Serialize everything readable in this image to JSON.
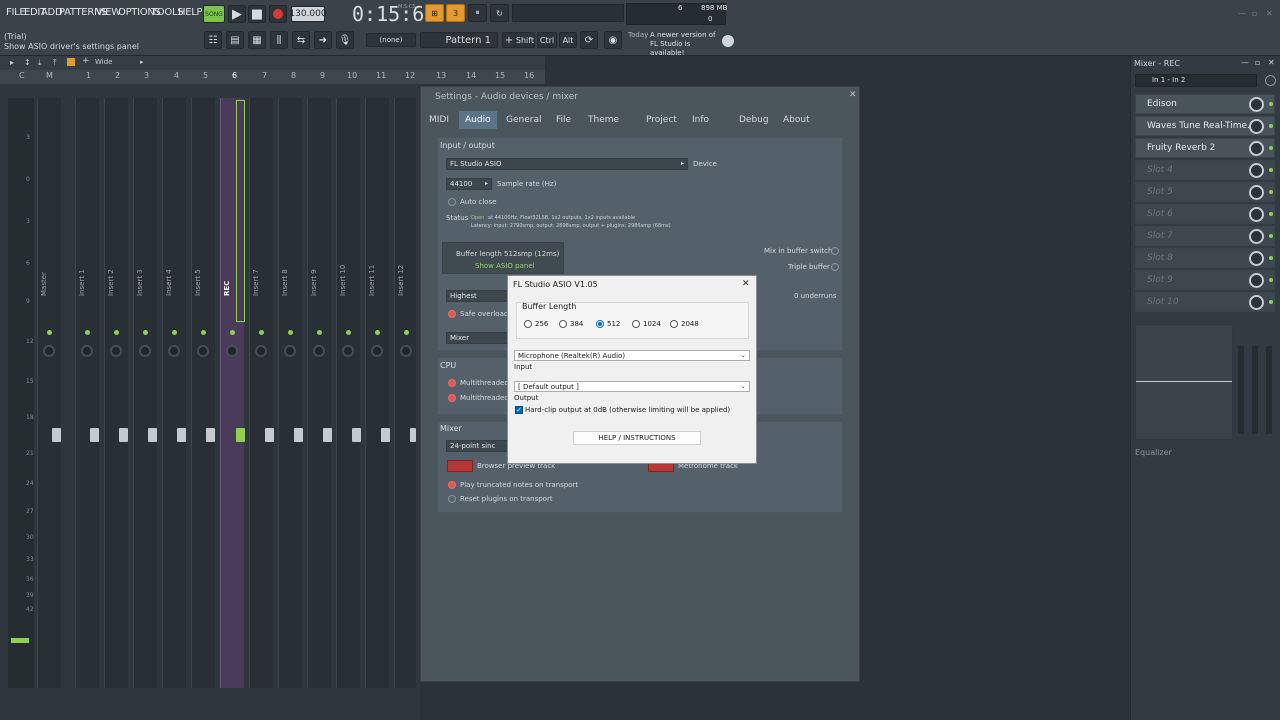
{
  "menu": [
    "FILE",
    "EDIT",
    "ADD",
    "PATTERNS",
    "VIEW",
    "OPTIONS",
    "TOOLS",
    "HELP"
  ],
  "hint": {
    "line1": "(Trial)",
    "line2": "Show ASIO driver's settings panel"
  },
  "transport": {
    "song_label": "SONG",
    "tempo": "130.000",
    "time": "0:15:60",
    "time_unit": "M:S:CS"
  },
  "perf": {
    "cpu": "6",
    "memory": "898 MB",
    "poly": "0"
  },
  "toolbar": {
    "channel": "(none)",
    "pattern": "Pattern 1",
    "shift": "Shift",
    "ctrl": "Ctrl",
    "alt": "Alt"
  },
  "news": {
    "when": "Today",
    "text": "A newer version of FL Studio is available!"
  },
  "mixer_toolbar": {
    "wide": "Wide"
  },
  "mixer_ruler": [
    "C",
    "M",
    "1",
    "2",
    "3",
    "4",
    "5",
    "6",
    "7",
    "8",
    "9",
    "10",
    "11",
    "12",
    "13",
    "14",
    "15",
    "16"
  ],
  "mixer_scale": [
    "3",
    "0",
    "3",
    "6",
    "9",
    "12",
    "15",
    "18",
    "21",
    "24",
    "27",
    "30",
    "33",
    "36",
    "39",
    "42"
  ],
  "tracks": [
    "Master",
    "Insert 1",
    "Insert 2",
    "Insert 3",
    "Insert 4",
    "Insert 5",
    "REC",
    "Insert 7",
    "Insert 8",
    "Insert 9",
    "Insert 10",
    "Insert 11",
    "Insert 12"
  ],
  "settings": {
    "title": "Settings - Audio devices / mixer",
    "tabs": [
      "MIDI",
      "Audio",
      "General",
      "File",
      "Theme",
      "Project",
      "Info",
      "Debug",
      "About"
    ],
    "io_title": "Input / output",
    "device": "FL Studio ASIO",
    "device_label": "Device",
    "sample_rate": "44100",
    "sample_rate_label": "Sample rate (Hz)",
    "auto_close": "Auto close",
    "status_label": "Status",
    "status_open": "Open",
    "status_line1": "at 44100Hz, Float32LSB, 1x2 outputs, 1x2 inputs available",
    "status_line2": "Latency: input: 2790smp, output: 2898smp, output + plugins: 2986smp (68ms)",
    "buffer_length": "Buffer length 512smp (12ms)",
    "show_asio": "Show ASIO panel",
    "mix_in_buffer": "Mix in buffer switch",
    "triple_buffer": "Triple buffer",
    "priority": "Highest",
    "underruns": "0 underruns",
    "safe_overloads": "Safe overloads",
    "mixer_label": "Mixer",
    "cpu_title": "CPU",
    "multithreaded1": "Multithreaded",
    "multithreaded2": "Multithreaded",
    "mixer_title": "Mixer",
    "interpolation": "24-point sinc",
    "browser_preview": "Browser preview track",
    "metronome": "Metronome track",
    "play_truncated": "Play truncated notes on transport",
    "reset_plugins": "Reset plugins on transport"
  },
  "asio": {
    "title": "FL Studio ASIO V1.05",
    "close": "✕",
    "buffer_length_label": "Buffer Length",
    "options": [
      "256",
      "384",
      "512",
      "1024",
      "2048"
    ],
    "selected": "512",
    "input_device": "Microphone (Realtek(R) Audio)",
    "input_label": "Input",
    "output_device": "[ Default output ]",
    "output_label": "Output",
    "hardclip": "Hard-clip output at 0dB (otherwise limiting will be applied)",
    "help_button": "HELP / INSTRUCTIONS"
  },
  "right_panel": {
    "title": "Mixer - REC",
    "routing": "In 1 - In 2",
    "slots": [
      "Edison",
      "Waves Tune Real-Time...",
      "Fruity Reverb 2",
      "Slot 4",
      "Slot 5",
      "Slot 6",
      "Slot 7",
      "Slot 8",
      "Slot 9",
      "Slot 10"
    ],
    "equalizer": "Equalizer"
  }
}
